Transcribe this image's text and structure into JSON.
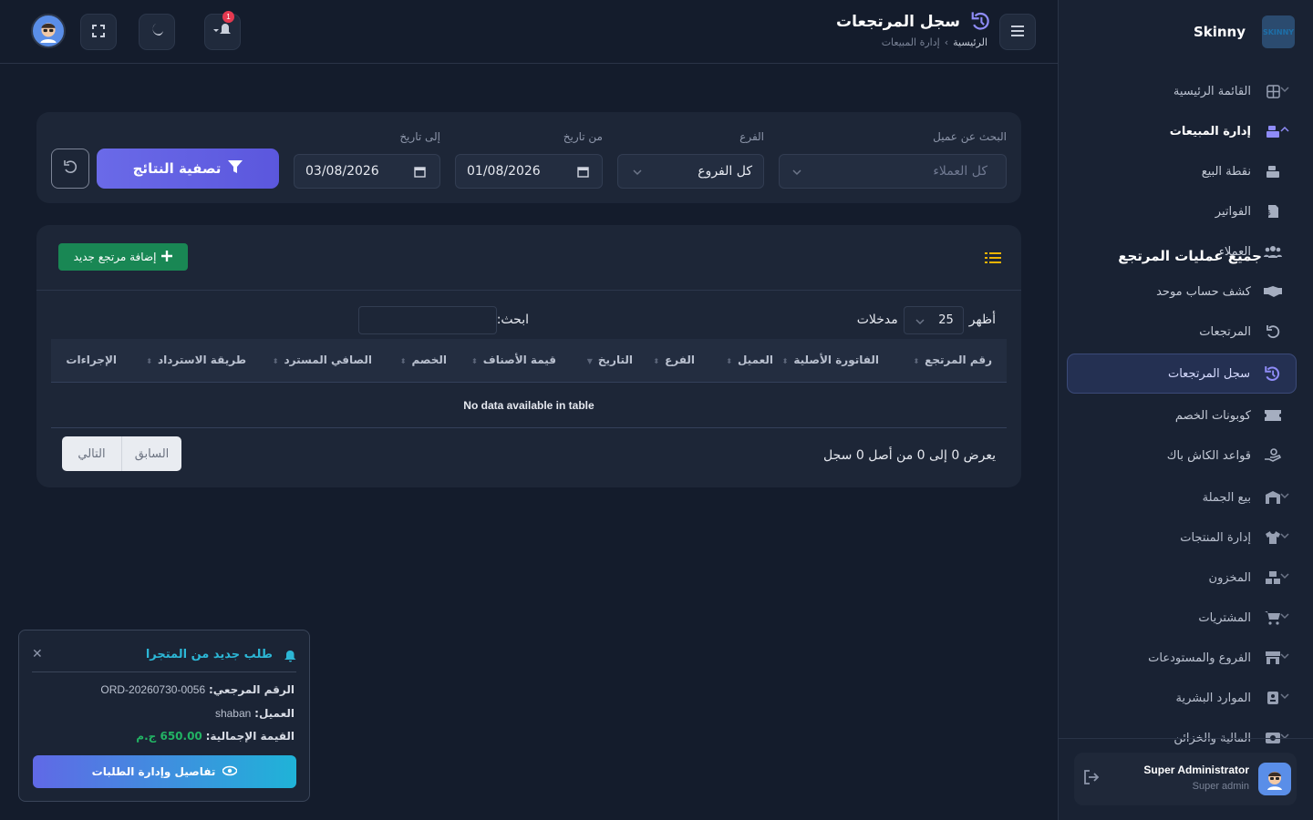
{
  "brand": {
    "name": "Skinny",
    "logo_text": "SKINNY"
  },
  "sidebar": {
    "groups": [
      {
        "label": "القائمة الرئيسية",
        "icon": "grid-icon"
      },
      {
        "label": "إدارة المبيعات",
        "icon": "cash-register-icon",
        "open": true
      }
    ],
    "sales_items": [
      {
        "label": "نقطة البيع",
        "icon": "cash-register-icon"
      },
      {
        "label": "الفواتير",
        "icon": "invoice-icon"
      },
      {
        "label": "العملاء",
        "icon": "users-icon"
      },
      {
        "label": "كشف حساب موحد",
        "icon": "handshake-icon"
      },
      {
        "label": "المرتجعات",
        "icon": "undo-icon"
      },
      {
        "label": "سجل المرتجعات",
        "icon": "history-icon",
        "active": true
      },
      {
        "label": "كوبونات الخصم",
        "icon": "ticket-icon"
      },
      {
        "label": "قواعد الكاش باك",
        "icon": "hand-coin-icon"
      }
    ],
    "more_groups": [
      {
        "label": "بيع الجملة",
        "icon": "warehouse-icon"
      },
      {
        "label": "إدارة المنتجات",
        "icon": "shirt-icon"
      },
      {
        "label": "المخزون",
        "icon": "boxes-icon"
      },
      {
        "label": "المشتريات",
        "icon": "cart-icon"
      },
      {
        "label": "الفروع والمستودعات",
        "icon": "store-icon"
      },
      {
        "label": "الموارد البشرية",
        "icon": "id-badge-icon"
      },
      {
        "label": "المالية والخزائن",
        "icon": "money-icon"
      }
    ],
    "user": {
      "name": "Super Administrator",
      "role": "Super admin"
    }
  },
  "header": {
    "title": "سجل المرتجعات",
    "breadcrumb_home": "الرئيسية",
    "breadcrumb_sep": "›",
    "breadcrumb_current": "إدارة المبيعات",
    "notification_count": "1"
  },
  "filters": {
    "customer_label": "البحث عن عميل",
    "customer_placeholder": "كل العملاء",
    "branch_label": "الفرع",
    "branch_value": "كل الفروع",
    "from_label": "من تاريخ",
    "from_value": "01/08/2026",
    "to_label": "إلى تاريخ",
    "to_value": "03/08/2026",
    "filter_button": "تصفية النتائج"
  },
  "table_card": {
    "title": "جميع عمليات المرتجع",
    "add_button": "إضافة مرتجع جديد",
    "show_label": "أظهر",
    "page_size": "25",
    "entries_label": "مدخلات",
    "search_label": "ابحث:",
    "columns": [
      "رقم المرتجع",
      "الفاتورة الأصلية",
      "العميل",
      "الفرع",
      "التاريخ",
      "قيمة الأصناف",
      "الخصم",
      "الصافي المسترد",
      "طريقة الاسترداد",
      "الإجراءات"
    ],
    "empty": "No data available in table",
    "info": "يعرض 0 إلى 0 من أصل 0 سجل",
    "prev": "السابق",
    "next": "التالي"
  },
  "toast": {
    "title": "طلب جديد من المتجرا",
    "ref_label": "الرقم المرجعي:",
    "ref_value": "ORD-20260730-0056",
    "customer_label": "العميل:",
    "customer_value": "shaban",
    "total_label": "القيمة الإجمالية:",
    "total_value": "650.00 ج.م",
    "button": "تفاصيل وإدارة الطلبات"
  },
  "colors": {
    "accent": "#6a6ae8",
    "success": "#198754",
    "info": "#2cb7d6",
    "warning": "#f0b400"
  }
}
